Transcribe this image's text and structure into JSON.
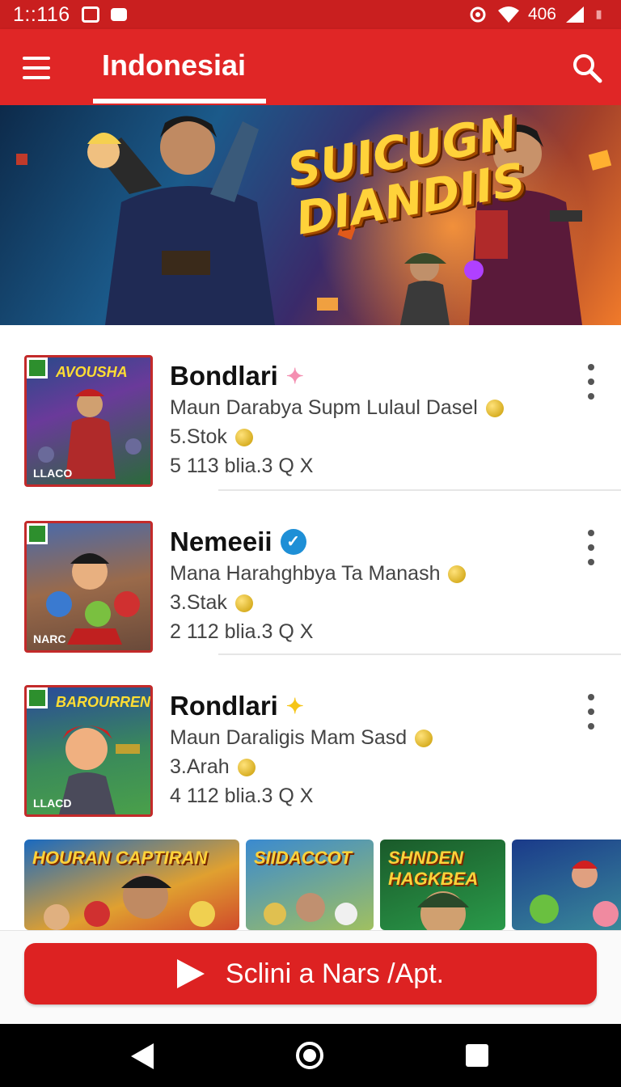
{
  "status_bar": {
    "time": "1::116",
    "network": "406",
    "icons": [
      "notification-icon",
      "message-icon",
      "alarm-icon",
      "wifi-icon",
      "signal-icon",
      "battery-icon"
    ]
  },
  "app_bar": {
    "title": "Indonesiai",
    "icons": [
      "menu-icon",
      "search-icon"
    ]
  },
  "banner": {
    "title": "SUICUGN DIANDIIS"
  },
  "items": [
    {
      "title": "Bondlari",
      "badge_icon": "sparkle-icon",
      "subtitle": "Maun Darabya Supm Lulaul Dasel",
      "rating": "5.Stok",
      "stats": "5 113 blia.3 Q X",
      "thumb_title": "AVOUSHA",
      "thumb_tag": "LLACO"
    },
    {
      "title": "Nemeeii",
      "badge_icon": "verified-icon",
      "subtitle": "Mana Harahghbya Ta Manash",
      "rating": "3.Stak",
      "stats": "2 112 blia.3 Q X",
      "thumb_title": "",
      "thumb_tag": "NARC"
    },
    {
      "title": "Rondlari",
      "badge_icon": "star-sparkle-icon",
      "subtitle": "Maun Daraligis Mam Sasd",
      "rating": "3.Arah",
      "stats": "4 112 blia.3 Q X",
      "thumb_title": "BAROURREN",
      "thumb_tag": "LLACD"
    }
  ],
  "carousel": [
    {
      "label": "HOURAN  CAPTIRAN"
    },
    {
      "label": "SIIDACCOT"
    },
    {
      "label": "SHNDEN HAGKBEA"
    },
    {
      "label": ""
    }
  ],
  "cta": {
    "label": "Sclini a Nars /Apt.",
    "icon": "play-icon"
  },
  "colors": {
    "brand_red": "#e02626",
    "status_red": "#c91f1f",
    "button_red": "#dd2222"
  }
}
